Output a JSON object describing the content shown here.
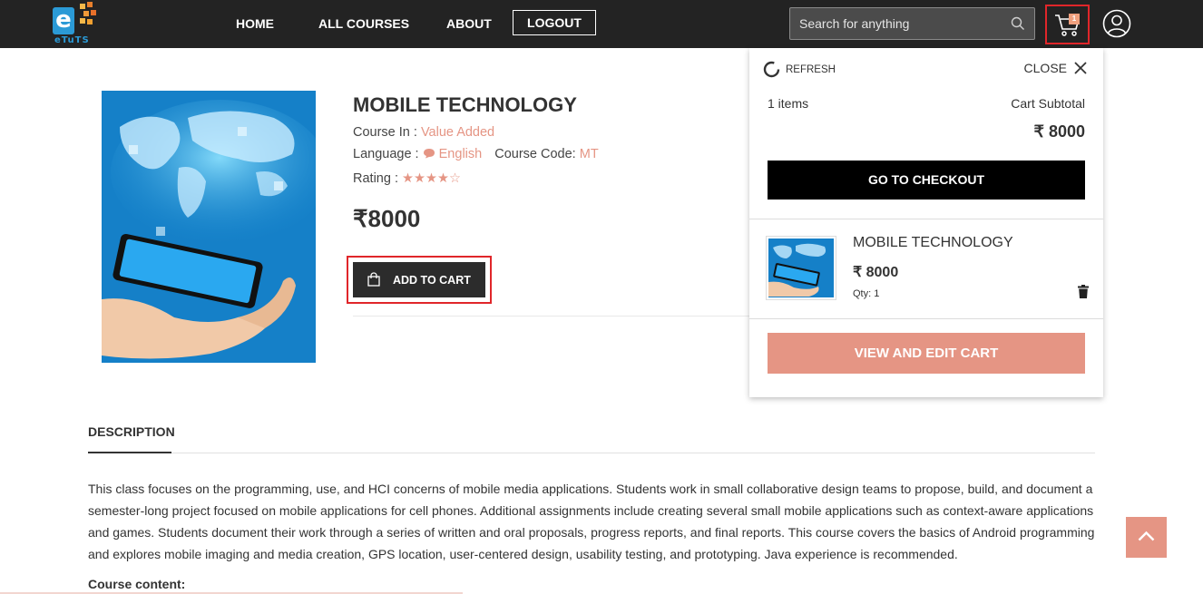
{
  "header": {
    "logo_text": "eTuTS",
    "nav": [
      "HOME",
      "ALL COURSES",
      "ABOUT"
    ],
    "logout_label": "LOGOUT",
    "search_placeholder": "Search for anything",
    "cart_count": "1"
  },
  "product": {
    "title": "MOBILE TECHNOLOGY",
    "course_in_label": "Course In :",
    "course_in_value": "Value Added",
    "language_label": "Language :",
    "language_value": "English",
    "course_code_label": "Course Code:",
    "course_code_value": "MT",
    "rating_label": "Rating :",
    "rating_stars": 4,
    "rating_max": 5,
    "price": "₹8000",
    "add_to_cart": "ADD TO CART"
  },
  "cart_dropdown": {
    "refresh": "REFRESH",
    "close": "CLOSE",
    "items_count": "1 items",
    "subtotal_label": "Cart Subtotal",
    "subtotal_value": "₹ 8000",
    "checkout": "GO TO CHECKOUT",
    "item": {
      "name": "MOBILE TECHNOLOGY",
      "price": "₹ 8000",
      "qty": "Qty: 1"
    },
    "view_edit": "VIEW AND EDIT CART"
  },
  "description": {
    "tab": "DESCRIPTION",
    "text": "This class focuses on the programming, use, and HCI concerns of mobile media applications. Students work in small collaborative design teams to propose, build, and document a semester-long project focused on mobile applications for cell phones. Additional assignments include creating several small mobile applications such as context-aware applications and games. Students document their work through a series of written and oral proposals, progress reports, and final reports. This course covers the basics of Android programming and explores mobile imaging and media creation, GPS location, user-centered design, usability testing, and prototyping. Java experience is recommended.",
    "course_content": "Course content:"
  },
  "colors": {
    "header_bg": "#232323",
    "accent": "#e59584",
    "highlight_border": "#e0262a"
  }
}
